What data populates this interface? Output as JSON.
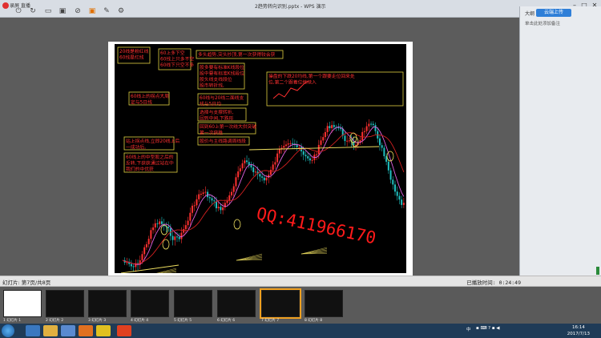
{
  "topbar": {
    "recorder_label": "录屏 直播",
    "doc_title": "2趋势转向识别.pptx - WPS 演示",
    "tools": [
      "power-icon",
      "refresh-icon",
      "message-icon",
      "box-icon",
      "mute-icon",
      "camera-icon",
      "record-icon",
      "brush-icon",
      "mic-icon",
      "settings-icon"
    ]
  },
  "right_panel": {
    "outline_tab": "大纲",
    "upload_button": "云端上传",
    "note_hint": "单击此处添加备注"
  },
  "status": {
    "slide_info": "幻灯片: 第7页/共8页",
    "play_time": "已播放时间: 0:24:49"
  },
  "thumbnails": [
    {
      "label": "1 幻灯片 1"
    },
    {
      "label": "2 幻灯片 2"
    },
    {
      "label": "3 幻灯片 3"
    },
    {
      "label": "4 幻灯片 4"
    },
    {
      "label": "5 幻灯片 5"
    },
    {
      "label": "6 幻灯片 6"
    },
    {
      "label": "7 幻灯片 7"
    },
    {
      "label": "8 幻灯片 8"
    }
  ],
  "taskbar": {
    "tray_lang": "中",
    "time": "16:14",
    "date": "2017/7/13"
  },
  "slide": {
    "annotations": {
      "a1": "20线是粉红线\n60线是红线",
      "a2": "60上多下空\n60线上只多不空\n60线下只空不多",
      "a3": "多头趋势,突头抄顶,第一次获得较会获",
      "a4": "股多要有标准K线段位\n股中要有标准K线段位\n股头线支线段位\n股市转折线,",
      "a5": "60线与20线二面线支\n线与5日均",
      "a6": "选择与支撑转折,\n回到中间,下跌形",
      "a7": "回到60上第一次绕大供突破\n第一次获胜",
      "a8": "股价与主线路调周线段",
      "a9": "60线上的拐点大周\n定与5日线",
      "a10": "站上拐点线,立即20线上后\n一成功后,",
      "a11": "60线上的中型股之后的\n反转,下获获通过站在中\n我们的中优获",
      "a12": "操盘的下跌20均线,第一个跟要走位回来处\n位,第二个跟着位继续入",
      "watermark": "QQ:411966170"
    }
  },
  "colors": {
    "chart_bg": "#000000",
    "candle_up": "#ff3030",
    "candle_down": "#20c0c0",
    "ma20": "#e060e0",
    "ma60": "#d02020",
    "annotation_text": "#ff3030",
    "annotation_border": "#e0d040",
    "watermark": "#ff1a1a"
  }
}
